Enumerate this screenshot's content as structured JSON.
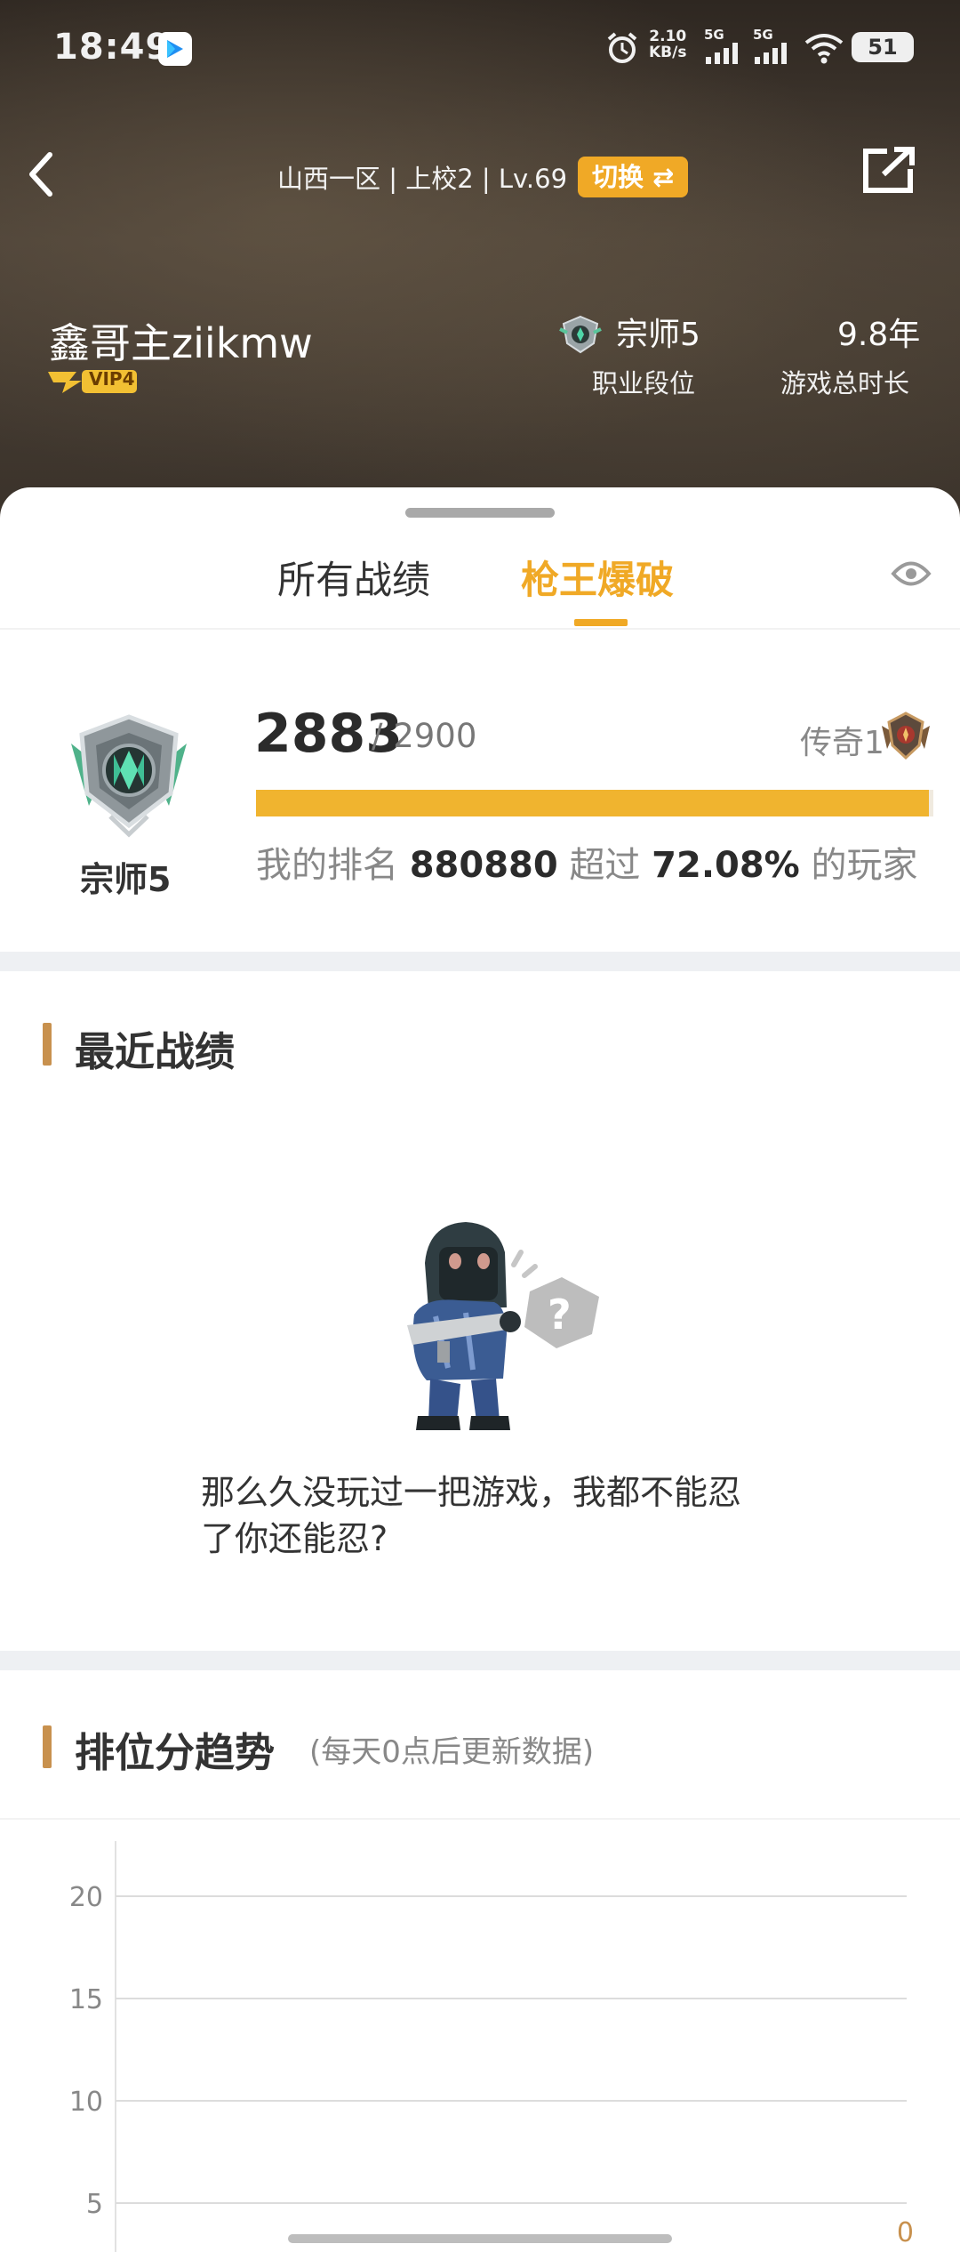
{
  "status_bar": {
    "time": "18:49",
    "net_speed_value": "2.10",
    "net_speed_unit": "KB/s",
    "signal_1_label": "5G",
    "signal_2_label": "5G",
    "battery": "51"
  },
  "header": {
    "server_line": "山西一区 | 上校2 | Lv.69",
    "switch_label": "切换 ⇄",
    "player_name": "鑫哥主ziikmw",
    "vip_label": "VIP4",
    "rank_value": "宗师5",
    "rank_label": "职业段位",
    "years_value": "9.8年",
    "years_label": "游戏总时长"
  },
  "tabs": [
    {
      "label": "所有战绩",
      "active": false
    },
    {
      "label": "枪王爆破",
      "active": true
    }
  ],
  "rank_card": {
    "rank_name": "宗师5",
    "score": "2883",
    "score_max": "/ 2900",
    "next_rank": "传奇1",
    "progress_fraction": 0.994,
    "ranking_prefix": "我的排名",
    "ranking_value": "880880",
    "exceed_prefix": "超过",
    "exceed_value": "72.08%",
    "exceed_suffix": "的玩家"
  },
  "recent": {
    "title": "最近战绩",
    "empty_message": "那么久没玩过一把游戏，我都不能忍了你还能忍?"
  },
  "trend": {
    "title": "排位分趋势",
    "note": "(每天0点后更新数据)"
  },
  "chart_data": {
    "type": "line",
    "title": "排位分趋势",
    "y_ticks": [
      "20",
      "15",
      "10",
      "5"
    ],
    "ylim": [
      0,
      20
    ],
    "series": [
      {
        "values": [
          0
        ]
      }
    ],
    "value_labels": [
      "0"
    ],
    "grid": true
  },
  "colors": {
    "accent": "#f0a926",
    "progress": "#f0b42f",
    "section_bar": "#c8914e"
  }
}
